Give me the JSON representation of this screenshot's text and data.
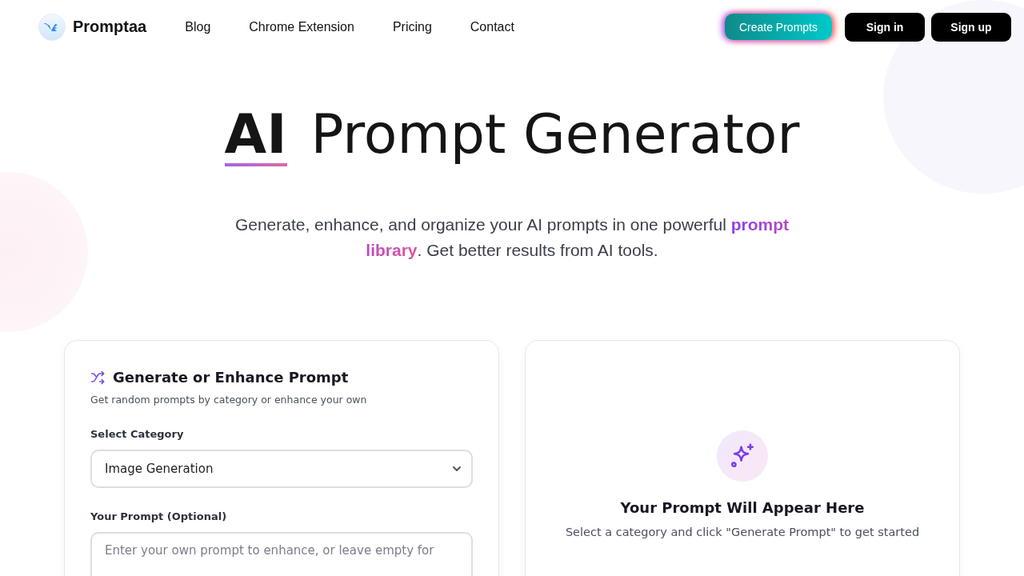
{
  "nav": {
    "brand": "Promptaa",
    "links": [
      "Blog",
      "Chrome Extension",
      "Pricing",
      "Contact"
    ],
    "cta": "Create Prompts",
    "buttons": [
      "Sign in",
      "Sign up"
    ]
  },
  "hero": {
    "title_bold": "AI",
    "title_rest": "Prompt Generator",
    "subtitle": "Generate, enhance, and organize your AI prompts in one powerful **prompt library**. Get better results from AI tools."
  },
  "generator": {
    "title": "Generate or Enhance Prompt",
    "description": "Get random prompts by category or enhance your own",
    "category_label": "Select Category",
    "category_value": "Image Generation",
    "prompt_label": "Your Prompt (Optional)",
    "prompt_placeholder": "Enter your own prompt to enhance, or leave empty for"
  },
  "output": {
    "title": "Your Prompt Will Appear Here",
    "hint": "Select a category and click \"Generate Prompt\" to get started"
  }
}
